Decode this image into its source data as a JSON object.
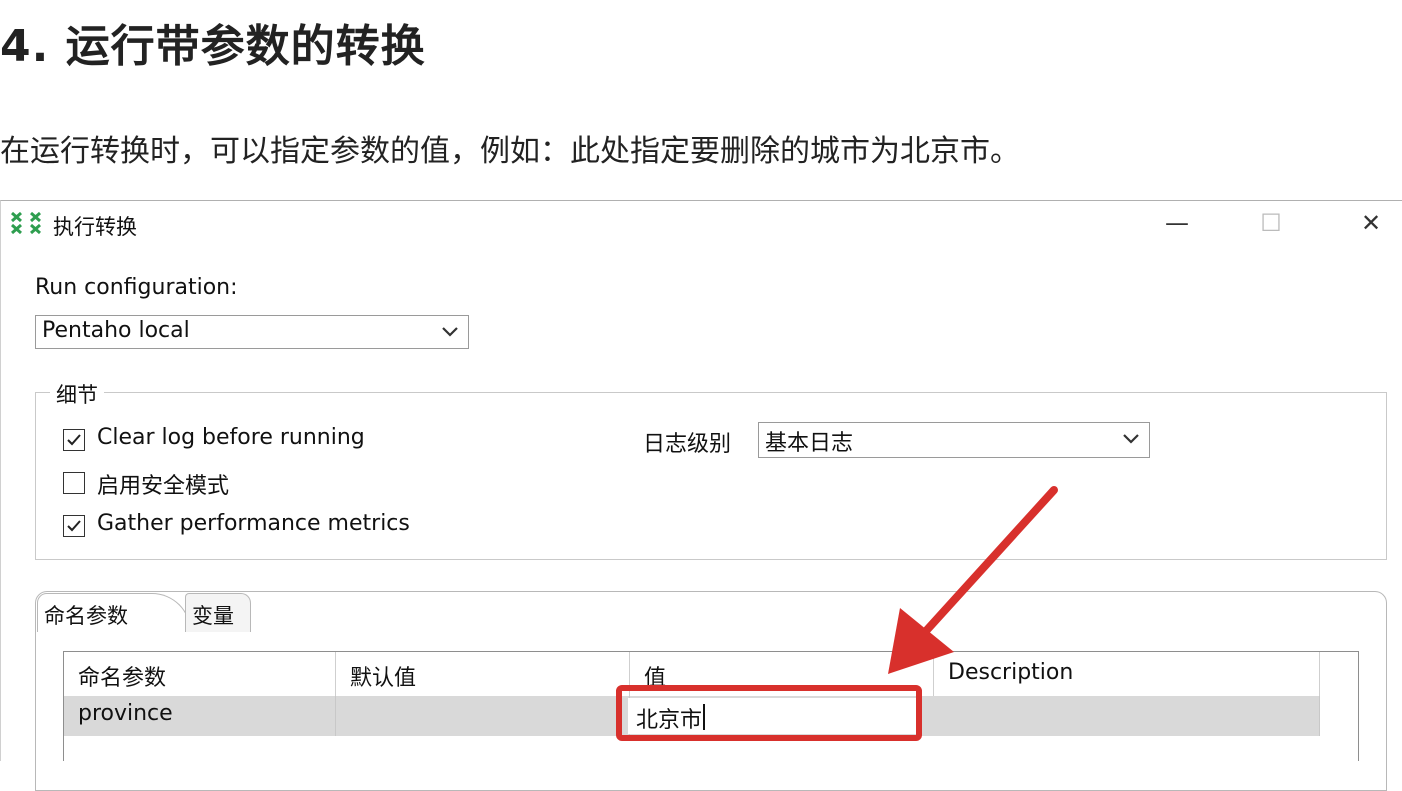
{
  "article": {
    "heading": "4. 运行带参数的转换",
    "paragraph": "在运行转换时，可以指定参数的值，例如：此处指定要删除的城市为北京市。"
  },
  "dialog": {
    "title": "执行转换",
    "window_buttons": {
      "minimize": "—",
      "maximize": "☐",
      "close": "✕"
    },
    "run_config_label": "Run configuration:",
    "run_config_value": "Pentaho local",
    "details_legend": "细节",
    "options": [
      {
        "label": "Clear log before running",
        "checked": true
      },
      {
        "label": "启用安全模式",
        "checked": false
      },
      {
        "label": "Gather performance metrics",
        "checked": true
      }
    ],
    "log_level_label": "日志级别",
    "log_level_value": "基本日志",
    "tabs": [
      {
        "label": "命名参数",
        "active": true
      },
      {
        "label": "变量",
        "active": false
      }
    ],
    "table": {
      "headers": [
        "命名参数",
        "默认值",
        "值",
        "Description"
      ],
      "rows": [
        {
          "name": "province",
          "default": "",
          "value": "北京市",
          "description": ""
        }
      ]
    }
  },
  "colors": {
    "annotation_red": "#d8302c",
    "selected_row": "#d9d9d9",
    "icon_green": "#2e9e4f"
  }
}
